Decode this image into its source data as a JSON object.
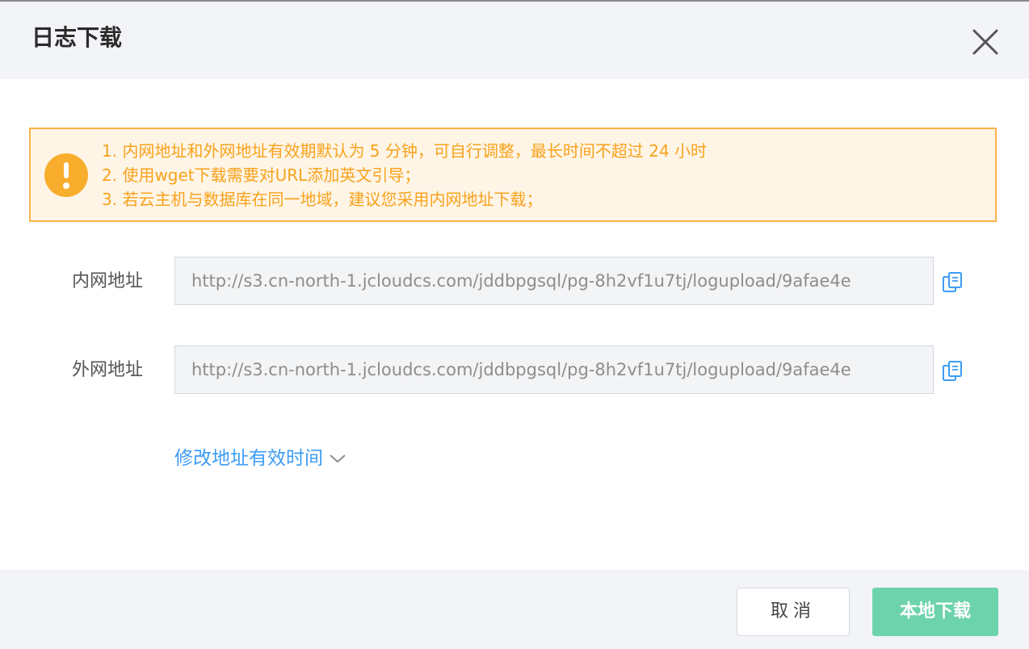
{
  "dialog": {
    "title": "日志下载"
  },
  "alert": {
    "lines": [
      "1. 内网地址和外网地址有效期默认为 5 分钟，可自行调整，最长时间不超过 24 小时",
      "2. 使用wget下载需要对URL添加英文引导；",
      "3. 若云主机与数据库在同一地域，建议您采用内网地址下载；"
    ],
    "icon": "warning-icon",
    "color": "#f8a21c"
  },
  "fields": {
    "internal": {
      "label": "内网地址",
      "value": "http://s3.cn-north-1.jcloudcs.com/jddbpgsql/pg-8h2vf1u7tj/logupload/9afae4e"
    },
    "external": {
      "label": "外网地址",
      "value": "http://s3.cn-north-1.jcloudcs.com/jddbpgsql/pg-8h2vf1u7tj/logupload/9afae4e"
    }
  },
  "modify_link": {
    "label": "修改地址有效时间"
  },
  "footer": {
    "cancel_label": "取消",
    "download_label": "本地下载"
  },
  "colors": {
    "link": "#3c9cf4",
    "primary": "#6dd3ac",
    "warning": "#f8ad2d"
  }
}
